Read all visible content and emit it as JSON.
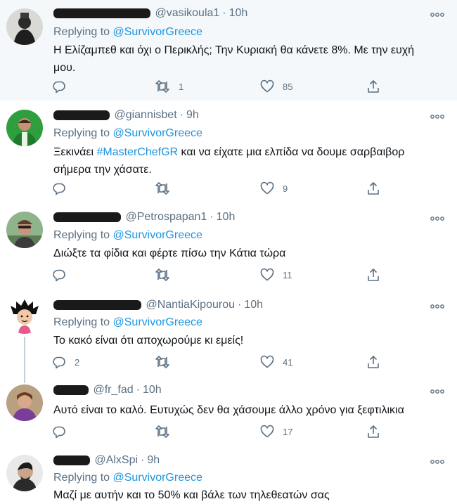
{
  "reply_prefix": "Replying to",
  "tweets": [
    {
      "handle": "@vasikoula1",
      "time": "10h",
      "reply_to": "@SurvivorGreece",
      "text": "Η Ελίζαμπεθ και όχι ο Περικλής; Την Κυριακή θα κάνετε 8%. Με την ευχή μου.",
      "replies": "",
      "retweets": "1",
      "likes": "85"
    },
    {
      "handle": "@giannisbet",
      "time": "9h",
      "reply_to": "@SurvivorGreece",
      "text_before": "Ξεκινάει ",
      "hashtag": "#MasterChefGR",
      "text_after": " και να είχατε μια ελπίδα να δουμε σαρβαιβορ σήμερα την χάσατε.",
      "replies": "",
      "retweets": "",
      "likes": "9"
    },
    {
      "handle": "@Petrospapan1",
      "time": "10h",
      "reply_to": "@SurvivorGreece",
      "text": "Διώξτε τα φίδια και φέρτε πίσω την Κάτια τώρα",
      "replies": "",
      "retweets": "",
      "likes": "11"
    },
    {
      "handle": "@NantiaKipourou",
      "time": "10h",
      "reply_to": "@SurvivorGreece",
      "text": "Το κακό είναι ότι αποχωρούμε κι εμείς!",
      "replies": "2",
      "retweets": "",
      "likes": "41"
    },
    {
      "handle": "@fr_fad",
      "time": "10h",
      "text": "Αυτό είναι το καλό. Ευτυχώς δεν θα χάσουμε άλλο χρόνο για ξεφτιλικια",
      "replies": "",
      "retweets": "",
      "likes": "17"
    },
    {
      "handle": "@AlxSpi",
      "time": "9h",
      "reply_to": "@SurvivorGreece",
      "text": "Μαζί με αυτήν και το 50% και βάλε των τηλεθεατών σας"
    }
  ]
}
